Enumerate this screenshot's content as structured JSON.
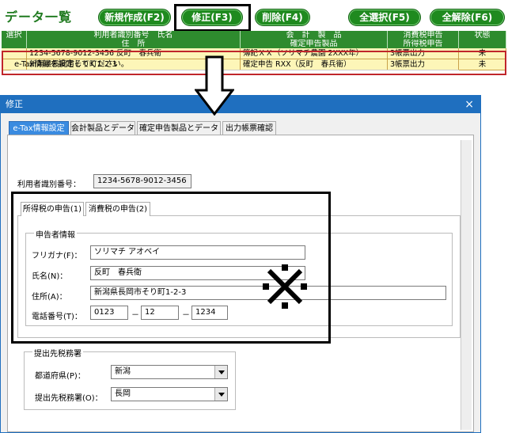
{
  "top": {
    "title": "データ一覧",
    "buttons": [
      "新規作成(F2)",
      "修正(F3)",
      "削除(F4)",
      "全選択(F5)",
      "全解除(F6)"
    ]
  },
  "grid": {
    "header1": [
      "選択",
      "利用者識別番号　氏名",
      "会　計　製　品",
      "消費税申告",
      "状態"
    ],
    "header2": [
      "住　所",
      "確定申告製品",
      "所得税申告"
    ],
    "rows": [
      [
        "1234-5678-9012-3456 反町　春兵衛",
        "簿記ＸＸ（ソリマチ農園 2XXX年）",
        "3帳票出力",
        "未"
      ],
      [
        "新潟県長岡市そり町1-2-3",
        "確定申告 RXX（反町　春兵衛）",
        "3帳票出力",
        "未"
      ]
    ]
  },
  "dialog": {
    "title": "修正",
    "close": "×",
    "tabs": [
      "e-Tax情報設定",
      "会計製品とデータ",
      "確定申告製品とデータ",
      "出力帳票確認"
    ],
    "description": "e-Tax情報を設定してください。",
    "user_id_label": "利用者識別番号：",
    "user_id_value": "1234-5678-9012-3456",
    "subtabs": [
      "所得税の申告(1)",
      "消費税の申告(2)"
    ],
    "filer_group": "申告者情報",
    "furigana_label": "フリガナ(F)：",
    "furigana_value": "ソリマチ アオベイ",
    "name_label": "氏名(N)：",
    "name_value": "反町　春兵衛",
    "address_label": "住所(A)：",
    "address_value": "新潟県長岡市そり町1-2-3",
    "phone_label": "電話番号(T)：",
    "phone1": "0123",
    "phone2": "12",
    "phone3": "1234",
    "phone_dash": "－",
    "office_group": "提出先税務署",
    "pref_label": "都道府県(P)：",
    "pref_value": "新潟",
    "office_label": "提出先税務署(O)：",
    "office_value": "長岡"
  }
}
